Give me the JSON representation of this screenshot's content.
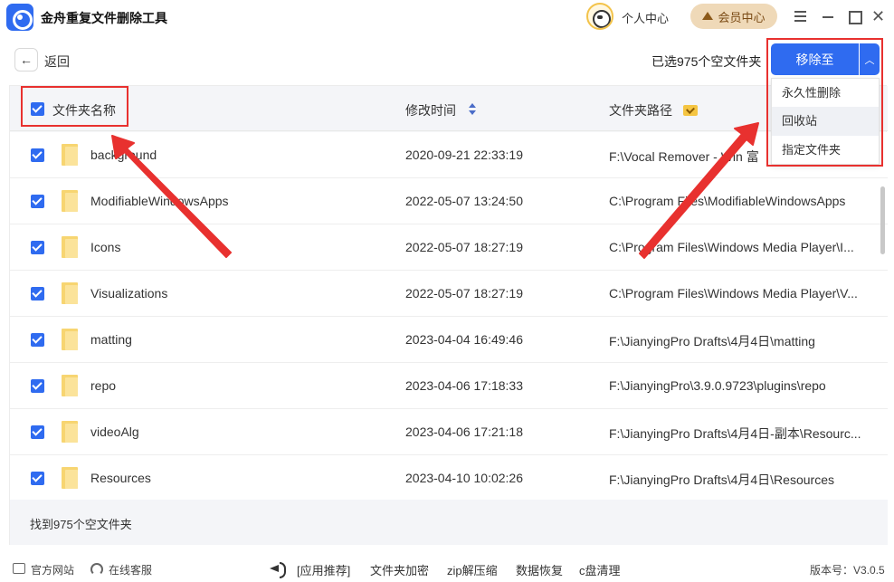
{
  "app": {
    "title": "金舟重复文件删除工具"
  },
  "header": {
    "user_center": "个人中心",
    "member_center": "会员中心"
  },
  "toolbar": {
    "back_label": "返回",
    "selected_count": "已选975个空文件夹",
    "move_button": "移除至"
  },
  "dropdown": {
    "items": [
      "永久性删除",
      "回收站",
      "指定文件夹"
    ]
  },
  "table": {
    "columns": [
      "文件夹名称",
      "修改时间",
      "文件夹路径"
    ],
    "rows": [
      {
        "name": "background",
        "time": "2020-09-21 22:33:19",
        "path": "F:\\Vocal Remover - Win 富"
      },
      {
        "name": "ModifiableWindowsApps",
        "time": "2022-05-07 13:24:50",
        "path": "C:\\Program Files\\ModifiableWindowsApps"
      },
      {
        "name": "Icons",
        "time": "2022-05-07 18:27:19",
        "path": "C:\\Program Files\\Windows Media Player\\I..."
      },
      {
        "name": "Visualizations",
        "time": "2022-05-07 18:27:19",
        "path": "C:\\Program Files\\Windows Media Player\\V..."
      },
      {
        "name": "matting",
        "time": "2023-04-04 16:49:46",
        "path": "F:\\JianyingPro Drafts\\4月4日\\matting"
      },
      {
        "name": "repo",
        "time": "2023-04-06 17:18:33",
        "path": "F:\\JianyingPro\\3.9.0.9723\\plugins\\repo"
      },
      {
        "name": "videoAlg",
        "time": "2023-04-06 17:21:18",
        "path": "F:\\JianyingPro Drafts\\4月4日-副本\\Resourc..."
      },
      {
        "name": "Resources",
        "time": "2023-04-10 10:02:26",
        "path": "F:\\JianyingPro Drafts\\4月4日\\Resources"
      }
    ],
    "footer": "找到975个空文件夹"
  },
  "bottombar": {
    "site": "官方网站",
    "support": "在线客服",
    "links": [
      "[应用推荐]",
      "文件夹加密",
      "zip解压缩",
      "数据恢复",
      "c盘清理"
    ],
    "version": "版本号：V3.0.5"
  },
  "colors": {
    "accent": "#2f6bf0",
    "highlight": "#e8312f",
    "member": "#efd9b8"
  }
}
